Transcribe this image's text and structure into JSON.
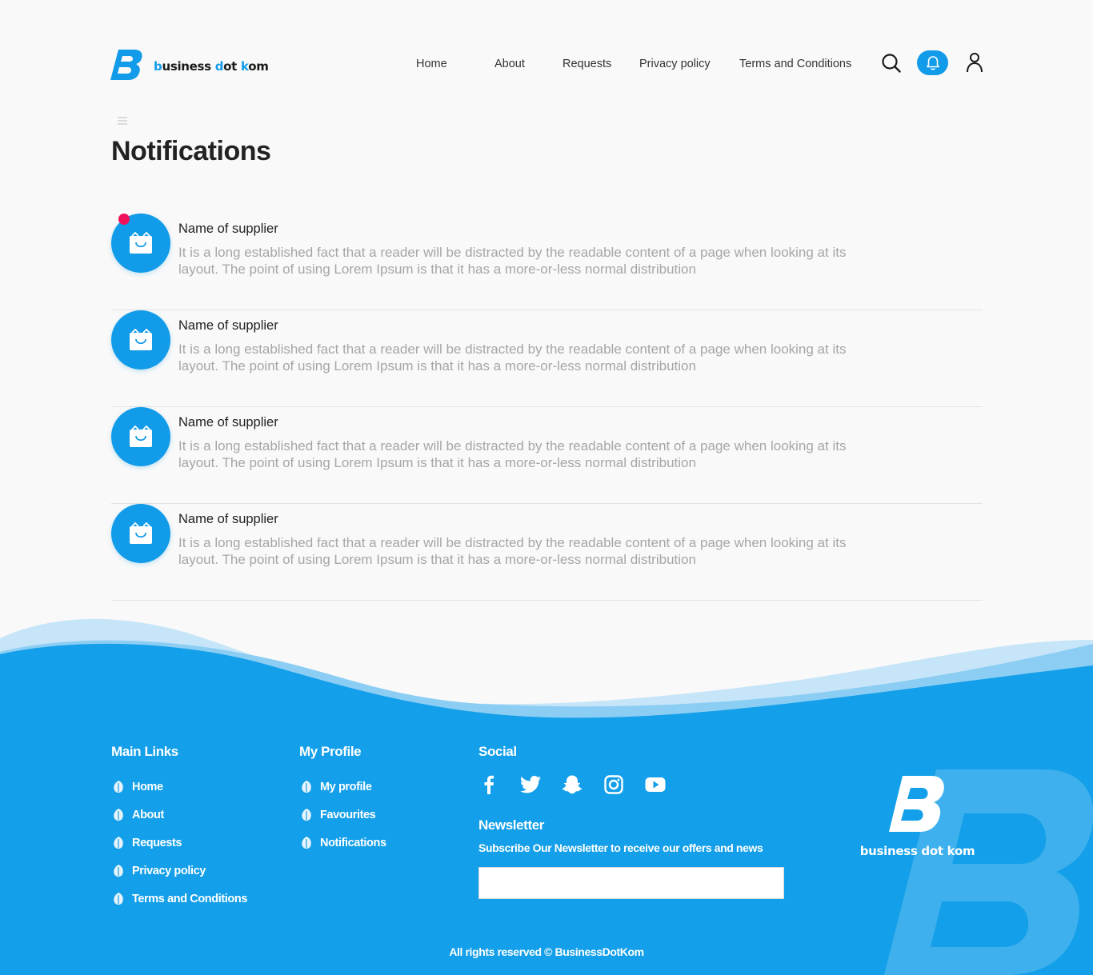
{
  "brand": {
    "logo_text_pre": "b",
    "logo_text_mid1": "usiness ",
    "logo_text_d": "d",
    "logo_text_mid2": "ot ",
    "logo_text_k": "k",
    "logo_text_end": "om",
    "accent_color": "#119be8"
  },
  "nav": {
    "items": [
      "Home",
      "About",
      "Requests",
      "Privacy policy",
      "Terms and Conditions"
    ]
  },
  "header_icons": [
    "search-icon",
    "bell-icon",
    "user-icon"
  ],
  "page": {
    "title": "Notifications"
  },
  "notifications": [
    {
      "name": "Name of supplier",
      "message": "It is a long established fact that a reader will be distracted by the readable content of a page when looking at its layout. The point of using Lorem Ipsum is that it has a more-or-less normal distribution",
      "unread": true
    },
    {
      "name": "Name of supplier",
      "message": "It is a long established fact that a reader will be distracted by the readable content of a page when looking at its layout. The point of using Lorem Ipsum is that it has a more-or-less normal distribution",
      "unread": false
    },
    {
      "name": "Name of supplier",
      "message": "It is a long established fact that a reader will be distracted by the readable content of a page when looking at its layout. The point of using Lorem Ipsum is that it has a more-or-less normal distribution",
      "unread": false
    },
    {
      "name": "Name of supplier",
      "message": "It is a long established fact that a reader will be distracted by the readable content of a page when looking at its layout. The point of using Lorem Ipsum is that it has a more-or-less normal distribution",
      "unread": false
    }
  ],
  "footer": {
    "main_links": {
      "title": "Main Links",
      "items": [
        "Home",
        "About",
        "Requests",
        "Privacy policy",
        "Terms and Conditions"
      ]
    },
    "my_profile": {
      "title": "My Profile",
      "items": [
        "My profile",
        "Favourites",
        "Notifications"
      ]
    },
    "social": {
      "title": "Social",
      "icons": [
        "facebook-icon",
        "twitter-icon",
        "snapchat-icon",
        "instagram-icon",
        "youtube-icon"
      ]
    },
    "newsletter": {
      "title": "Newsletter",
      "subtitle": "Subscribe Our Newsletter to receive our offers and news",
      "placeholder": ""
    },
    "logo_text": "business dot kom",
    "copyright": "All rights reserved © BusinessDotKom"
  },
  "colors": {
    "primary": "#119be8",
    "unread_dot": "#f0115a",
    "footer_bg": "#139fe9"
  }
}
